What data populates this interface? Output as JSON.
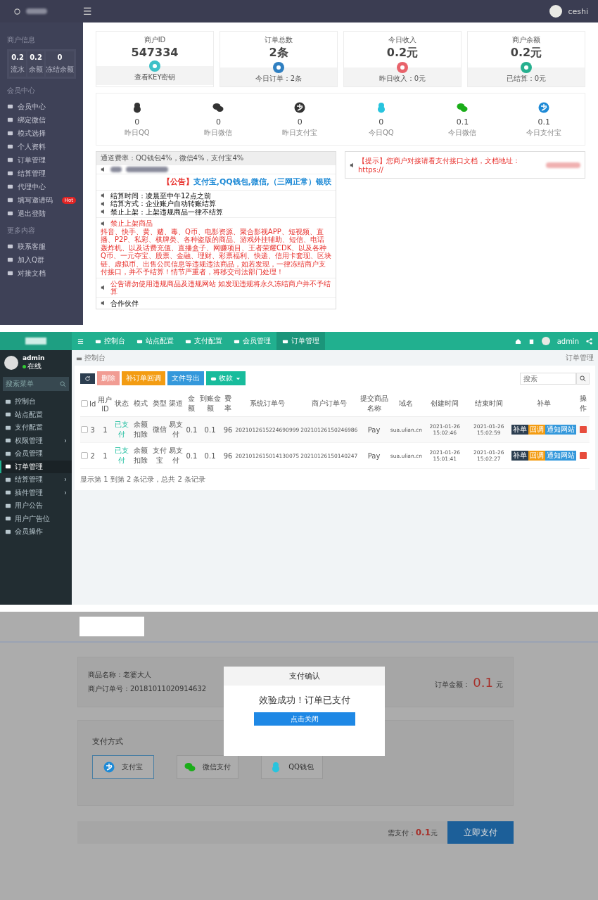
{
  "merchant_panel": {
    "topbar": {
      "menu_icon": "☰",
      "username": "ceshi"
    },
    "sidebar": {
      "account_title": "商户信息",
      "stats": [
        {
          "value": "0.2",
          "label": "流水"
        },
        {
          "value": "0.2",
          "label": "余额"
        },
        {
          "value": "0",
          "label": "冻结余额"
        }
      ],
      "sections": [
        {
          "title": "会员中心",
          "items": [
            {
              "label": "会员中心"
            },
            {
              "label": "绑定微信"
            },
            {
              "label": "模式选择"
            },
            {
              "label": "个人资料"
            },
            {
              "label": "订单管理"
            },
            {
              "label": "结算管理"
            },
            {
              "label": "代理中心"
            },
            {
              "label": "填写邀请码",
              "badge": "Hot"
            },
            {
              "label": "退出登陆"
            }
          ]
        },
        {
          "title": "更多内容",
          "items": [
            {
              "label": "联系客服"
            },
            {
              "label": "加入Q群"
            },
            {
              "label": "对接文档"
            }
          ]
        }
      ]
    },
    "cards": [
      {
        "title": "商户ID",
        "value": "547334",
        "footer": "查看KEY密钥",
        "color": "#3ec1c8"
      },
      {
        "title": "订单总数",
        "value": "2条",
        "footer": "今日订单：2条",
        "color": "#2f7fc1"
      },
      {
        "title": "今日收入",
        "value": "0.2元",
        "footer": "昨日收入：0元",
        "color": "#e8636b"
      },
      {
        "title": "商户余额",
        "value": "0.2元",
        "footer": "已结算：0元",
        "color": "#26b08f"
      }
    ],
    "channel_stats": [
      {
        "kind": "qq",
        "muted": true,
        "value": "0",
        "label": "昨日QQ"
      },
      {
        "kind": "wechat",
        "muted": true,
        "value": "0",
        "label": "昨日微信"
      },
      {
        "kind": "alipay",
        "muted": true,
        "value": "0",
        "label": "昨日支付宝"
      },
      {
        "kind": "qq",
        "muted": false,
        "value": "0",
        "label": "今日QQ"
      },
      {
        "kind": "wechat",
        "muted": false,
        "value": "0.1",
        "label": "今日微信"
      },
      {
        "kind": "alipay",
        "muted": false,
        "value": "0.1",
        "label": "今日支付宝"
      }
    ],
    "notice": {
      "header": "通道费率：QQ钱包4%，微信4%，支付宝4%",
      "headline_tag": "【公告】",
      "headline": "支付宝,QQ钱包,微信,（三网正常）银联",
      "rules": [
        "结算时间：凌晨至中午12点之前",
        "结算方式：企业账户自动转账结算",
        "禁止上架：上架违规商品一律不结算"
      ],
      "banned_title": "禁止上架商品",
      "banned_text": "抖音、快手、黄、赌、毒、Q币、电影资源、聚合影视APP、短视频、直播、P2P、私彩、棋牌类、各种盗版的商品、游戏外挂辅助、短信、电话轰炸机、以及话费充值、直播盒子、网赚项目、王者荣耀CDK、以及各种Q币、一元夺宝、股票、金融、理财、彩票福利、快递、信用卡套现、区块链、虚拟币、出售公民信息等违规违法商品，如若发现，一律冻结商户支付接口，并不予结算！情节严重者，将移交司法部门处理！",
      "warning": "公告请勿使用违规商品及违规网站 如发现违规将永久冻结商户并不予结算",
      "partners": "合作伙伴"
    },
    "tip": "【提示】您商户对接请看支付接口文档，文档地址：https://"
  },
  "admin_panel": {
    "topnav": [
      {
        "label": "控制台",
        "selected": false
      },
      {
        "label": "站点配置",
        "selected": false
      },
      {
        "label": "支付配置",
        "selected": false
      },
      {
        "label": "会员管理",
        "selected": false
      },
      {
        "label": "订单管理",
        "selected": true
      }
    ],
    "user": "admin",
    "profile": {
      "name": "admin",
      "status": "在线"
    },
    "menu_search": "搜索菜单",
    "menu": [
      {
        "label": "控制台",
        "selected": false,
        "submenu": false
      },
      {
        "label": "站点配置",
        "selected": false,
        "submenu": false
      },
      {
        "label": "支付配置",
        "selected": false,
        "submenu": false
      },
      {
        "label": "权限管理",
        "selected": false,
        "submenu": true
      },
      {
        "label": "会员管理",
        "selected": false,
        "submenu": false
      },
      {
        "label": "订单管理",
        "selected": true,
        "submenu": false
      },
      {
        "label": "结算管理",
        "selected": false,
        "submenu": true
      },
      {
        "label": "插件管理",
        "selected": false,
        "submenu": true
      },
      {
        "label": "用户公告",
        "selected": false,
        "submenu": false
      },
      {
        "label": "用户广告位",
        "selected": false,
        "submenu": false
      },
      {
        "label": "会员操作",
        "selected": false,
        "submenu": false
      }
    ],
    "breadcrumb": "控制台",
    "page_title": "订单管理",
    "toolbar": [
      {
        "kind": "refresh"
      },
      {
        "kind": "danger",
        "label": "删除",
        "disabled": true
      },
      {
        "kind": "warning",
        "label": "补订单回调",
        "disabled": false
      },
      {
        "kind": "info",
        "label": "文件导出",
        "disabled": false
      },
      {
        "kind": "success",
        "label": "收款",
        "disabled": false
      }
    ],
    "search_placeholder": "搜索",
    "table": {
      "all_checked": false,
      "columns": [
        "Id",
        "用户ID",
        "状态",
        "模式",
        "类型",
        "渠道",
        "金额",
        "到账金额",
        "费率",
        "系统订单号",
        "商户订单号",
        "提交商品名称",
        "域名",
        "创建时间",
        "结束时间",
        "补单",
        "操作"
      ],
      "rows": [
        {
          "checked": false,
          "cells": [
            "3",
            "1",
            "已支付",
            "余额扣除",
            "微信",
            "易支付",
            "0.1",
            "0.1",
            "96",
            "2021012615224690999",
            "20210126150246986",
            "Pay",
            "sua.ulian.cn",
            "2021-01-26 15:02:46",
            "2021-01-26 15:02:59"
          ],
          "actions": [
            "补单",
            "回调",
            "通知网站"
          ]
        },
        {
          "checked": false,
          "cells": [
            "2",
            "1",
            "已支付",
            "余额扣除",
            "支付宝",
            "易支付",
            "0.1",
            "0.1",
            "96",
            "2021012615014130075",
            "20210126150140247",
            "Pay",
            "sua.ulian.cn",
            "2021-01-26 15:01:41",
            "2021-01-26 15:02:27"
          ],
          "actions": [
            "补单",
            "回调",
            "通知网站"
          ]
        }
      ]
    },
    "pagination": "显示第 1 到第 2 条记录，总共 2 条记录"
  },
  "payment_page": {
    "product_label": "商品名称：",
    "product": "老婆大人",
    "order_label": "商户订单号：",
    "order_no": "20181011020914632",
    "amount_label": "订单金额：",
    "amount": "0.1",
    "currency": "元",
    "method_title": "支付方式",
    "methods": [
      {
        "kind": "alipay",
        "label": "支付宝",
        "selected": true
      },
      {
        "kind": "wechat",
        "label": "微信支付",
        "selected": false
      },
      {
        "kind": "qq",
        "label": "QQ钱包",
        "selected": false
      }
    ],
    "due_label": "需支付：",
    "due": "0.1",
    "due_unit": "元",
    "pay_button": "立即支付",
    "dialog": {
      "title": "支付确认",
      "message": "效验成功！订单已支付",
      "button": "点击关闭"
    }
  }
}
